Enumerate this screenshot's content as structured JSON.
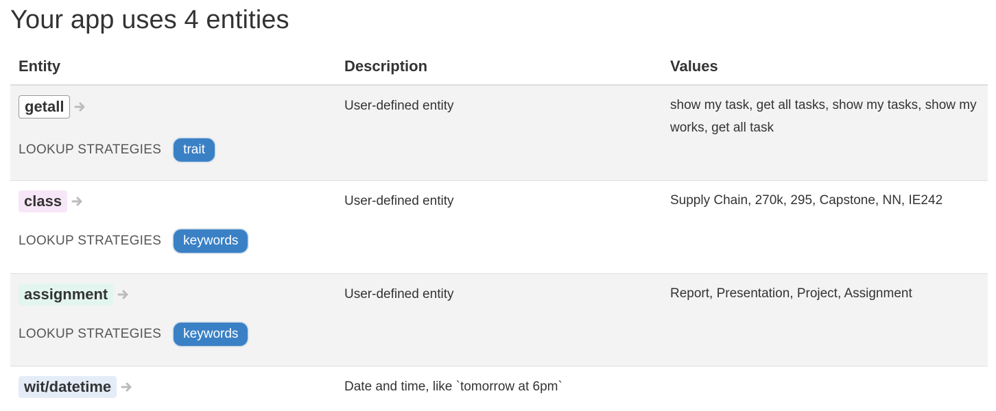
{
  "page": {
    "title": "Your app uses 4 entities"
  },
  "table": {
    "headers": {
      "entity": "Entity",
      "description": "Description",
      "values": "Values"
    },
    "rows": [
      {
        "entity": "getall",
        "tag_color": "#ffffff",
        "strategy_label": "LOOKUP STRATEGIES",
        "strategy": "trait",
        "description": "User-defined entity",
        "values": "show my task, get all tasks, show my tasks, show my works, get all task"
      },
      {
        "entity": "class",
        "tag_color": "#f7e6f7",
        "strategy_label": "LOOKUP STRATEGIES",
        "strategy": "keywords",
        "description": "User-defined entity",
        "values": "Supply Chain, 270k, 295, Capstone, NN, IE242"
      },
      {
        "entity": "assignment",
        "tag_color": "#e3f5ef",
        "strategy_label": "LOOKUP STRATEGIES",
        "strategy": "keywords",
        "description": "User-defined entity",
        "values": "Report, Presentation, Project, Assignment"
      },
      {
        "entity": "wit/datetime",
        "tag_color": "#e4ecf8",
        "description": "Date and time, like `tomorrow at 6pm`",
        "values": ""
      }
    ]
  },
  "colors": {
    "badge": "#3a80c5",
    "stripe": "#f3f3f3",
    "arrow": "#bbbbbb"
  },
  "icons": {
    "entity_link": "arrow-right-icon"
  }
}
